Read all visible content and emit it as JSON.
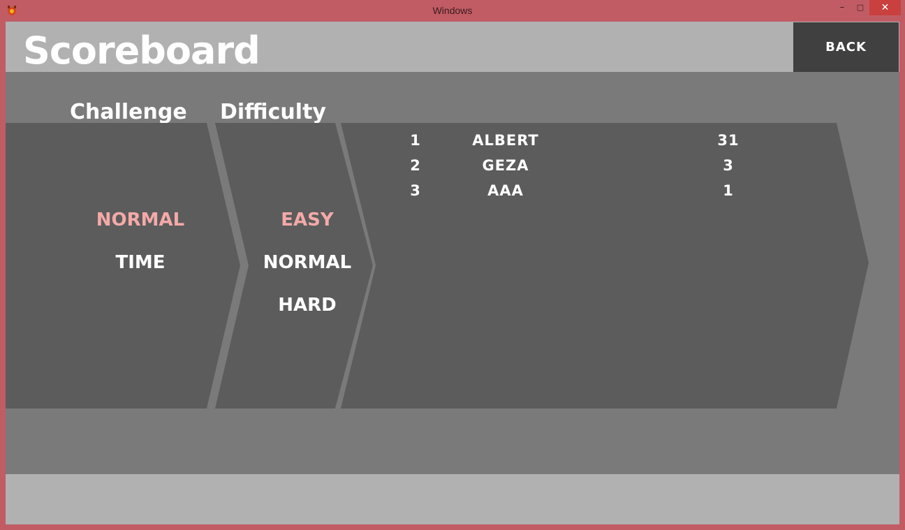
{
  "window": {
    "title": "Windows",
    "minimize_glyph": "–",
    "maximize_glyph": "□",
    "close_glyph": "✕"
  },
  "header": {
    "title": "Scoreboard",
    "back_label": "BACK"
  },
  "challenge": {
    "heading": "Challenge",
    "options": [
      {
        "label": "NORMAL",
        "selected": true
      },
      {
        "label": "TIME",
        "selected": false
      }
    ]
  },
  "difficulty": {
    "heading": "Difficulty",
    "options": [
      {
        "label": "EASY",
        "selected": true
      },
      {
        "label": "NORMAL",
        "selected": false
      },
      {
        "label": "HARD",
        "selected": false
      }
    ]
  },
  "scores": [
    {
      "rank": "1",
      "name": "ALBERT",
      "score": "31"
    },
    {
      "rank": "2",
      "name": "GEZA",
      "score": "3"
    },
    {
      "rank": "3",
      "name": "AAA",
      "score": "1"
    }
  ],
  "colors": {
    "selected": "#f4a9a9",
    "frame": "#c15c64",
    "panel": "#5c5c5c",
    "background": "#7a7a7a",
    "bars": "#b1b1b1"
  }
}
